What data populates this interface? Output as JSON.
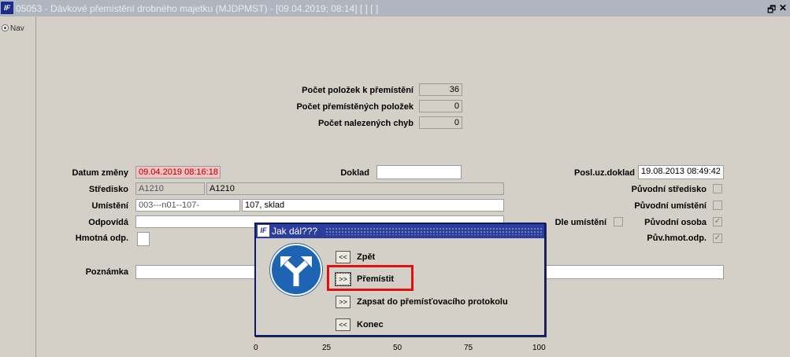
{
  "window": {
    "title": "05053 - Dávkové přemístění drobného majetku (MJDPMST) - [09.04.2019; 08:14]  [ ]  [ ]",
    "logo": "IF"
  },
  "nav": {
    "label": "Nav"
  },
  "stats": {
    "pocet_polozek_label": "Počet položek k přemístění",
    "pocet_polozek_value": "36",
    "premistenych_label": "Počet přemístěných položek",
    "premistenych_value": "0",
    "chyb_label": "Počet nalezených chyb",
    "chyb_value": "0"
  },
  "form": {
    "datum_label": "Datum změny",
    "datum_value": "09.04.2019 08:16:18",
    "doklad_label": "Doklad",
    "doklad_value": "",
    "posl_label": "Posl.uz.doklad",
    "posl_value": "19.08.2013 08:49:42",
    "stredisko_label": "Středisko",
    "stredisko_code": "A1210",
    "stredisko_name": "A1210",
    "puv_stredisko_label": "Původní středisko",
    "umisteni_label": "Umístění",
    "umisteni_code": "003---n01--107-",
    "umisteni_name": "107, sklad",
    "puv_umisteni_label": "Původní umístění",
    "odpovida_label": "Odpovídá",
    "odpovida_value": "",
    "dle_umisteni_label": "Dle umístění",
    "puv_osoba_label": "Původní osoba",
    "hmotna_label": "Hmotná odp.",
    "puv_hmot_label": "Pův.hmot.odp.",
    "poznamka_label": "Poznámka",
    "poznamka_value": "",
    "checked_mark": "✓"
  },
  "dialog": {
    "title": "Jak dál???",
    "options": [
      {
        "button": "<<",
        "label": "Zpět"
      },
      {
        "button": ">>",
        "label": "Přemístit"
      },
      {
        "button": ">>",
        "label": "Zapsat do přemísťovacího protokolu"
      },
      {
        "button": "<<",
        "label": "Konec"
      }
    ]
  },
  "progress": {
    "ticks": [
      "0",
      "25",
      "50",
      "75",
      "100"
    ]
  },
  "colors": {
    "accent": "#2c3e9c",
    "highlight": "#e01010",
    "error_bg": "#f4c0c0"
  }
}
